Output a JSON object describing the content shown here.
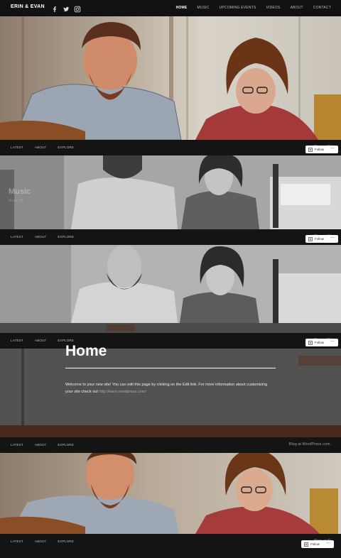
{
  "header": {
    "site_title": "ERIN & EVAN",
    "social_icons": [
      "facebook-icon",
      "twitter-icon",
      "instagram-icon"
    ],
    "nav": [
      "HOME",
      "MUSIC",
      "UPCOMING EVENTS",
      "VIDEOS",
      "ABOUT",
      "CONTACT"
    ],
    "active_nav": "HOME"
  },
  "footer": {
    "links": [
      "LATEST",
      "ABOUT",
      "EXPLORE"
    ],
    "blog_credit": "Blog at WordPress.com.",
    "blog_credit_truncated": "Blog at W",
    "follow_label": "Follow",
    "more_label": "..."
  },
  "ghost": {
    "title": "Music",
    "subtitle": "March 28"
  },
  "page": {
    "title": "Home",
    "body": "Welcome to your new site! You can edit this page by clicking on the Edit link. For more information about customizing your site check out ",
    "link_text": "http://learn.wordpress.com/"
  },
  "colors": {
    "bar": "#141414",
    "text_light": "#ffffff",
    "text_muted": "#bdbdbd"
  }
}
